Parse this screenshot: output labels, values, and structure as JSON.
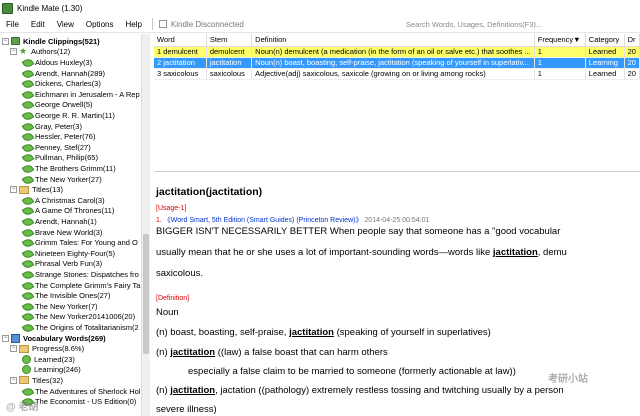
{
  "window": {
    "title": "Kindle Mate (1.30)"
  },
  "menu": {
    "file": "File",
    "edit": "Edit",
    "view": "View",
    "options": "Options",
    "help": "Help",
    "kindle_status": "Kindle Disconnected"
  },
  "search": {
    "placeholder": "Search Words, Usages, Definitions(F3)..."
  },
  "tree": {
    "root": "Kindle Clippings(521)",
    "authors": "Authors(12)",
    "author_items": [
      "Aldous Huxley(3)",
      "Arendt, Hannah(289)",
      "Dickens, Charles(3)",
      "Eichmann in Jerusalem - A Rep",
      "George Orwell(5)",
      "George R. R. Martin(11)",
      "Gray, Peter(3)",
      "Hessler, Peter(76)",
      "Penney, Stef(27)",
      "Pullman, Philip(65)",
      "The Brothers Grimm(11)",
      "The New Yorker(27)"
    ],
    "titles": "Titles(13)",
    "title_items": [
      "A Christmas Carol(3)",
      "A Game Of Thrones(11)",
      "Arendt, Hannah(1)",
      "Brave New World(3)",
      "Grimm Tales: For Young and O",
      "Nineteen Eighty-Four(5)",
      "Phrasal Verb Fun(3)",
      "Strange Stones: Dispatches fro",
      "The Complete Grimm's Fairy Ta",
      "The Invisible Ones(27)",
      "The New Yorker(7)",
      "The New Yorker20141006(20)",
      "The Origins of Totalitarianism(2"
    ],
    "vocab": "Vocabulary Words(269)",
    "progress": "Progress(8.6%)",
    "learned": "Learned(23)",
    "learning": "Learning(246)",
    "vocab_titles": "Titles(32)",
    "vocab_title_items": [
      "The Adventures of Sherlock Hol",
      "The Economist - US Edition(0)"
    ]
  },
  "table": {
    "headers": {
      "word": "Word",
      "stem": "Stem",
      "definition": "Definition",
      "frequency": "Frequency▼",
      "category": "Category",
      "date": "Dr"
    },
    "rows": [
      {
        "word": "1 demulcent",
        "stem": "demulcent",
        "definition": "Noun(n) demulcent (a medication (in the form of an oil or salve etc.) that soothes ...",
        "frequency": "1",
        "category": "Learned",
        "date": "20"
      },
      {
        "word": "2 jactitation",
        "stem": "jactitation",
        "definition": "Noun(n) boast, boasting, self-praise, jactitation (speaking of yourself in superlativ...",
        "frequency": "1",
        "category": "Learning",
        "date": "20"
      },
      {
        "word": "3 saxicolous",
        "stem": "saxicolous",
        "definition": "Adjective(adj) saxicolous, saxicole (growing on or living among rocks)",
        "frequency": "1",
        "category": "Learned",
        "date": "20"
      }
    ]
  },
  "detail": {
    "title": "jactitation(jactitation)",
    "usage_label": "[Usage-1]",
    "usage_num": "1.",
    "usage_source": "《Word Smart, 5th Edition (Smart Guides) (Princeton Review)》",
    "usage_date": "2014-04-25 00:54:01",
    "usage_line1": "BIGGER ISN'T NECESSARILY BETTER When people say that someone has a \"good vocabular",
    "usage_line2_pre": "usually mean that he or she uses a lot of important-sounding words—words like ",
    "usage_word": "jactitation",
    "usage_line2_post": ", demu",
    "usage_line3": "saxicolous.",
    "definition_label": "[Definition]",
    "noun_label": "Noun",
    "def1_pre": "(n) boast, boasting, self-praise, ",
    "def1_word": "jactitation",
    "def1_post": " (speaking of yourself in superlatives)",
    "def2_pre": "(n) ",
    "def2_word": "jactitation",
    "def2_post": " ((law) a false boast that can harm others",
    "def2b": "especially a false claim to be married to someone (formerly actionable at law))",
    "def3_pre": "(n) ",
    "def3_word": "jactitation",
    "def3_post": ", jactation ((pathology) extremely restless tossing and twitching usually by a person",
    "def3b": "severe illness)"
  },
  "watermark": {
    "left": "@ 老胡",
    "right": "考研小站"
  }
}
